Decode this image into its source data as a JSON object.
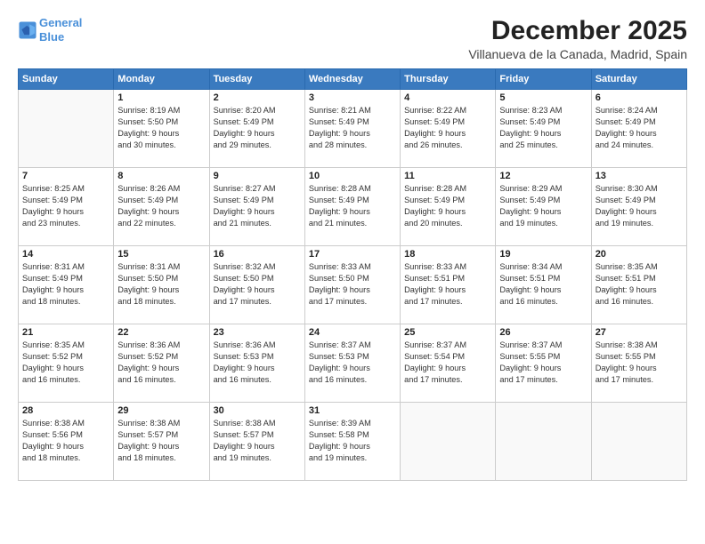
{
  "header": {
    "logo_line1": "General",
    "logo_line2": "Blue",
    "title": "December 2025",
    "subtitle": "Villanueva de la Canada, Madrid, Spain"
  },
  "days_header": [
    "Sunday",
    "Monday",
    "Tuesday",
    "Wednesday",
    "Thursday",
    "Friday",
    "Saturday"
  ],
  "weeks": [
    [
      {
        "day": "",
        "detail": ""
      },
      {
        "day": "1",
        "detail": "Sunrise: 8:19 AM\nSunset: 5:50 PM\nDaylight: 9 hours\nand 30 minutes."
      },
      {
        "day": "2",
        "detail": "Sunrise: 8:20 AM\nSunset: 5:49 PM\nDaylight: 9 hours\nand 29 minutes."
      },
      {
        "day": "3",
        "detail": "Sunrise: 8:21 AM\nSunset: 5:49 PM\nDaylight: 9 hours\nand 28 minutes."
      },
      {
        "day": "4",
        "detail": "Sunrise: 8:22 AM\nSunset: 5:49 PM\nDaylight: 9 hours\nand 26 minutes."
      },
      {
        "day": "5",
        "detail": "Sunrise: 8:23 AM\nSunset: 5:49 PM\nDaylight: 9 hours\nand 25 minutes."
      },
      {
        "day": "6",
        "detail": "Sunrise: 8:24 AM\nSunset: 5:49 PM\nDaylight: 9 hours\nand 24 minutes."
      }
    ],
    [
      {
        "day": "7",
        "detail": "Sunrise: 8:25 AM\nSunset: 5:49 PM\nDaylight: 9 hours\nand 23 minutes."
      },
      {
        "day": "8",
        "detail": "Sunrise: 8:26 AM\nSunset: 5:49 PM\nDaylight: 9 hours\nand 22 minutes."
      },
      {
        "day": "9",
        "detail": "Sunrise: 8:27 AM\nSunset: 5:49 PM\nDaylight: 9 hours\nand 21 minutes."
      },
      {
        "day": "10",
        "detail": "Sunrise: 8:28 AM\nSunset: 5:49 PM\nDaylight: 9 hours\nand 21 minutes."
      },
      {
        "day": "11",
        "detail": "Sunrise: 8:28 AM\nSunset: 5:49 PM\nDaylight: 9 hours\nand 20 minutes."
      },
      {
        "day": "12",
        "detail": "Sunrise: 8:29 AM\nSunset: 5:49 PM\nDaylight: 9 hours\nand 19 minutes."
      },
      {
        "day": "13",
        "detail": "Sunrise: 8:30 AM\nSunset: 5:49 PM\nDaylight: 9 hours\nand 19 minutes."
      }
    ],
    [
      {
        "day": "14",
        "detail": "Sunrise: 8:31 AM\nSunset: 5:49 PM\nDaylight: 9 hours\nand 18 minutes."
      },
      {
        "day": "15",
        "detail": "Sunrise: 8:31 AM\nSunset: 5:50 PM\nDaylight: 9 hours\nand 18 minutes."
      },
      {
        "day": "16",
        "detail": "Sunrise: 8:32 AM\nSunset: 5:50 PM\nDaylight: 9 hours\nand 17 minutes."
      },
      {
        "day": "17",
        "detail": "Sunrise: 8:33 AM\nSunset: 5:50 PM\nDaylight: 9 hours\nand 17 minutes."
      },
      {
        "day": "18",
        "detail": "Sunrise: 8:33 AM\nSunset: 5:51 PM\nDaylight: 9 hours\nand 17 minutes."
      },
      {
        "day": "19",
        "detail": "Sunrise: 8:34 AM\nSunset: 5:51 PM\nDaylight: 9 hours\nand 16 minutes."
      },
      {
        "day": "20",
        "detail": "Sunrise: 8:35 AM\nSunset: 5:51 PM\nDaylight: 9 hours\nand 16 minutes."
      }
    ],
    [
      {
        "day": "21",
        "detail": "Sunrise: 8:35 AM\nSunset: 5:52 PM\nDaylight: 9 hours\nand 16 minutes."
      },
      {
        "day": "22",
        "detail": "Sunrise: 8:36 AM\nSunset: 5:52 PM\nDaylight: 9 hours\nand 16 minutes."
      },
      {
        "day": "23",
        "detail": "Sunrise: 8:36 AM\nSunset: 5:53 PM\nDaylight: 9 hours\nand 16 minutes."
      },
      {
        "day": "24",
        "detail": "Sunrise: 8:37 AM\nSunset: 5:53 PM\nDaylight: 9 hours\nand 16 minutes."
      },
      {
        "day": "25",
        "detail": "Sunrise: 8:37 AM\nSunset: 5:54 PM\nDaylight: 9 hours\nand 17 minutes."
      },
      {
        "day": "26",
        "detail": "Sunrise: 8:37 AM\nSunset: 5:55 PM\nDaylight: 9 hours\nand 17 minutes."
      },
      {
        "day": "27",
        "detail": "Sunrise: 8:38 AM\nSunset: 5:55 PM\nDaylight: 9 hours\nand 17 minutes."
      }
    ],
    [
      {
        "day": "28",
        "detail": "Sunrise: 8:38 AM\nSunset: 5:56 PM\nDaylight: 9 hours\nand 18 minutes."
      },
      {
        "day": "29",
        "detail": "Sunrise: 8:38 AM\nSunset: 5:57 PM\nDaylight: 9 hours\nand 18 minutes."
      },
      {
        "day": "30",
        "detail": "Sunrise: 8:38 AM\nSunset: 5:57 PM\nDaylight: 9 hours\nand 19 minutes."
      },
      {
        "day": "31",
        "detail": "Sunrise: 8:39 AM\nSunset: 5:58 PM\nDaylight: 9 hours\nand 19 minutes."
      },
      {
        "day": "",
        "detail": ""
      },
      {
        "day": "",
        "detail": ""
      },
      {
        "day": "",
        "detail": ""
      }
    ]
  ]
}
